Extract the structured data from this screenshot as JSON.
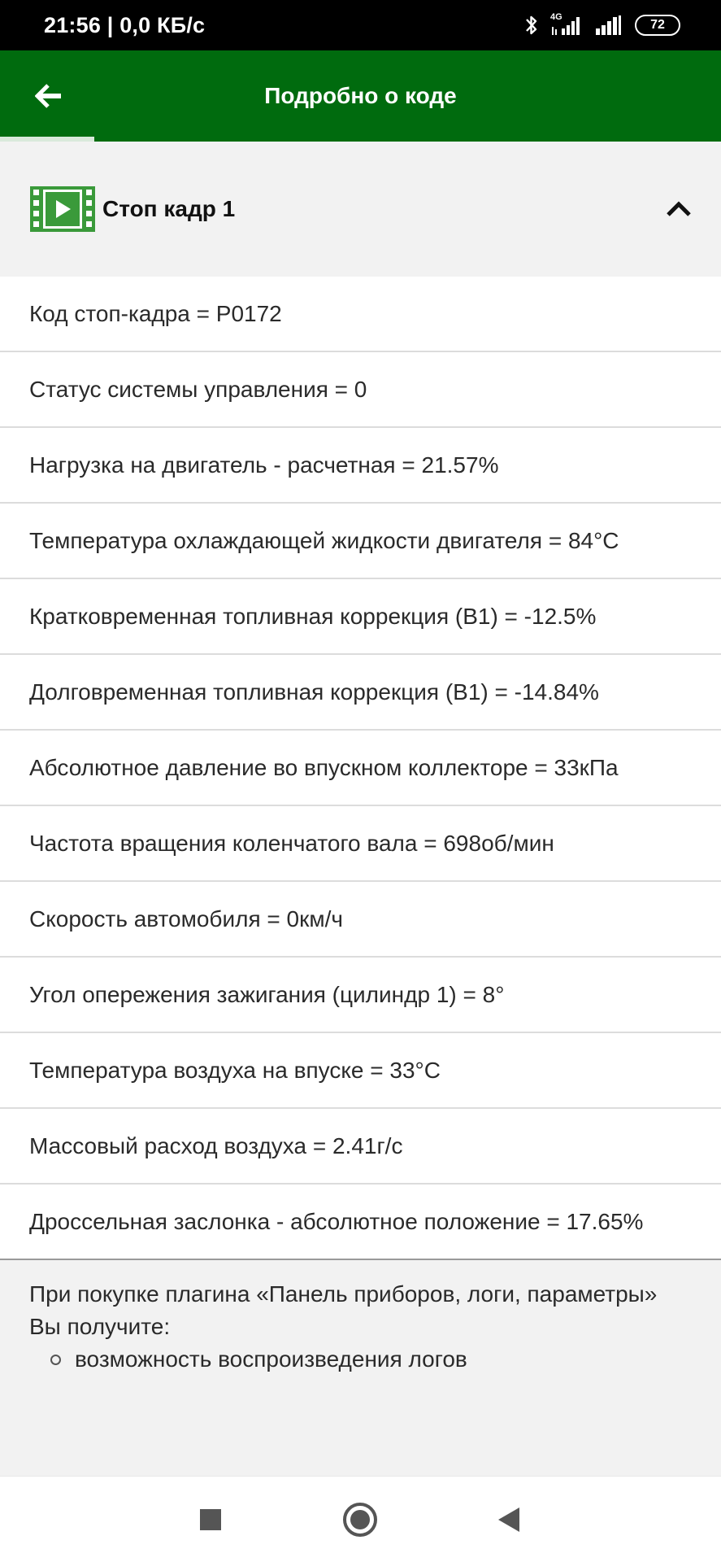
{
  "status_bar": {
    "time": "21:56 | 0,0 КБ/с",
    "network_label": "4G",
    "battery_level": "72",
    "icons": [
      "bluetooth-icon",
      "signal-icon",
      "signal-icon",
      "battery-icon"
    ]
  },
  "app_bar": {
    "title": "Подробно о коде",
    "back_icon": "arrow-left-icon",
    "color": "#006b0e"
  },
  "section": {
    "title": "Стоп кадр 1",
    "icon": "film-play-icon",
    "icon_color": "#3a9a3a",
    "toggle_icon": "chevron-up-icon"
  },
  "params": [
    "Код стоп-кадра = P0172",
    "Статус системы управления = 0",
    "Нагрузка на двигатель - расчетная = 21.57%",
    "Температура охлаждающей жидкости двигателя = 84°C",
    "Кратковременная топливная коррекция (B1) = -12.5%",
    "Долговременная топливная коррекция (B1) = -14.84%",
    "Абсолютное давление во впускном коллекторе = 33кПа",
    "Частота вращения коленчатого вала = 698об/мин",
    "Скорость автомобиля = 0км/ч",
    "Угол опережения зажигания (цилиндр 1) = 8°",
    "Температура воздуха на впуске = 33°C",
    "Массовый расход воздуха = 2.41г/с",
    "Дроссельная заслонка - абсолютное положение = 17.65%"
  ],
  "promo": {
    "text": "При покупке плагина «Панель приборов, логи, параметры» Вы получите:",
    "items": [
      "возможность воспроизведения логов"
    ]
  },
  "nav_bar": {
    "icons": [
      "square-recents-icon",
      "circle-home-icon",
      "triangle-back-icon"
    ]
  }
}
